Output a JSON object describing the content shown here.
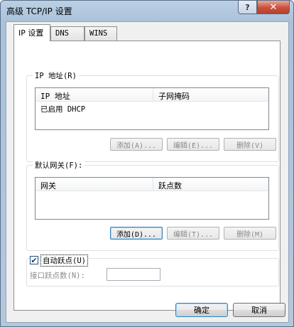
{
  "window": {
    "title": "高级 TCP/IP 设置",
    "help_label": "?",
    "close_label": "✕"
  },
  "tabs": [
    {
      "label": "IP 设置",
      "active": true
    },
    {
      "label": "DNS",
      "active": false
    },
    {
      "label": "WINS",
      "active": false
    }
  ],
  "ip_group": {
    "legend": "IP 地址(R)",
    "columns": [
      "IP 地址",
      "子网掩码"
    ],
    "rows": [
      [
        "已启用 DHCP",
        ""
      ]
    ],
    "add_label": "添加(A)...",
    "edit_label": "编辑(E)...",
    "delete_label": "删除(V)"
  },
  "gateway_group": {
    "legend": "默认网关(F):",
    "columns": [
      "网关",
      "跃点数"
    ],
    "add_label": "添加(D)...",
    "edit_label": "编辑(T)...",
    "delete_label": "删除(M)"
  },
  "metric": {
    "auto_label": "自动跃点(U)",
    "auto_checked": true,
    "interface_label": "接口跃点数(N):",
    "interface_value": ""
  },
  "footer": {
    "ok_label": "确定",
    "cancel_label": "取消"
  }
}
